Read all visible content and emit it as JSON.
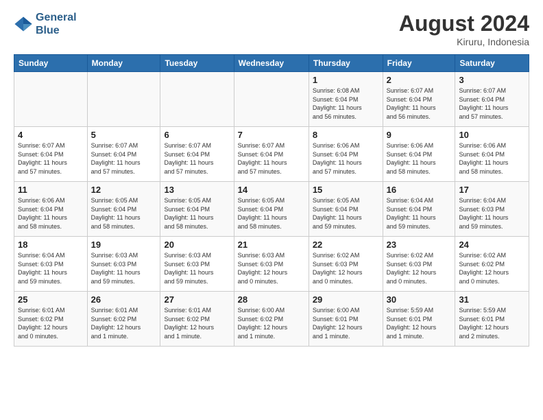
{
  "header": {
    "logo_line1": "General",
    "logo_line2": "Blue",
    "month_title": "August 2024",
    "subtitle": "Kiruru, Indonesia"
  },
  "weekdays": [
    "Sunday",
    "Monday",
    "Tuesday",
    "Wednesday",
    "Thursday",
    "Friday",
    "Saturday"
  ],
  "weeks": [
    [
      {
        "day": "",
        "info": ""
      },
      {
        "day": "",
        "info": ""
      },
      {
        "day": "",
        "info": ""
      },
      {
        "day": "",
        "info": ""
      },
      {
        "day": "1",
        "info": "Sunrise: 6:08 AM\nSunset: 6:04 PM\nDaylight: 11 hours\nand 56 minutes."
      },
      {
        "day": "2",
        "info": "Sunrise: 6:07 AM\nSunset: 6:04 PM\nDaylight: 11 hours\nand 56 minutes."
      },
      {
        "day": "3",
        "info": "Sunrise: 6:07 AM\nSunset: 6:04 PM\nDaylight: 11 hours\nand 57 minutes."
      }
    ],
    [
      {
        "day": "4",
        "info": "Sunrise: 6:07 AM\nSunset: 6:04 PM\nDaylight: 11 hours\nand 57 minutes."
      },
      {
        "day": "5",
        "info": "Sunrise: 6:07 AM\nSunset: 6:04 PM\nDaylight: 11 hours\nand 57 minutes."
      },
      {
        "day": "6",
        "info": "Sunrise: 6:07 AM\nSunset: 6:04 PM\nDaylight: 11 hours\nand 57 minutes."
      },
      {
        "day": "7",
        "info": "Sunrise: 6:07 AM\nSunset: 6:04 PM\nDaylight: 11 hours\nand 57 minutes."
      },
      {
        "day": "8",
        "info": "Sunrise: 6:06 AM\nSunset: 6:04 PM\nDaylight: 11 hours\nand 57 minutes."
      },
      {
        "day": "9",
        "info": "Sunrise: 6:06 AM\nSunset: 6:04 PM\nDaylight: 11 hours\nand 58 minutes."
      },
      {
        "day": "10",
        "info": "Sunrise: 6:06 AM\nSunset: 6:04 PM\nDaylight: 11 hours\nand 58 minutes."
      }
    ],
    [
      {
        "day": "11",
        "info": "Sunrise: 6:06 AM\nSunset: 6:04 PM\nDaylight: 11 hours\nand 58 minutes."
      },
      {
        "day": "12",
        "info": "Sunrise: 6:05 AM\nSunset: 6:04 PM\nDaylight: 11 hours\nand 58 minutes."
      },
      {
        "day": "13",
        "info": "Sunrise: 6:05 AM\nSunset: 6:04 PM\nDaylight: 11 hours\nand 58 minutes."
      },
      {
        "day": "14",
        "info": "Sunrise: 6:05 AM\nSunset: 6:04 PM\nDaylight: 11 hours\nand 58 minutes."
      },
      {
        "day": "15",
        "info": "Sunrise: 6:05 AM\nSunset: 6:04 PM\nDaylight: 11 hours\nand 59 minutes."
      },
      {
        "day": "16",
        "info": "Sunrise: 6:04 AM\nSunset: 6:04 PM\nDaylight: 11 hours\nand 59 minutes."
      },
      {
        "day": "17",
        "info": "Sunrise: 6:04 AM\nSunset: 6:03 PM\nDaylight: 11 hours\nand 59 minutes."
      }
    ],
    [
      {
        "day": "18",
        "info": "Sunrise: 6:04 AM\nSunset: 6:03 PM\nDaylight: 11 hours\nand 59 minutes."
      },
      {
        "day": "19",
        "info": "Sunrise: 6:03 AM\nSunset: 6:03 PM\nDaylight: 11 hours\nand 59 minutes."
      },
      {
        "day": "20",
        "info": "Sunrise: 6:03 AM\nSunset: 6:03 PM\nDaylight: 11 hours\nand 59 minutes."
      },
      {
        "day": "21",
        "info": "Sunrise: 6:03 AM\nSunset: 6:03 PM\nDaylight: 12 hours\nand 0 minutes."
      },
      {
        "day": "22",
        "info": "Sunrise: 6:02 AM\nSunset: 6:03 PM\nDaylight: 12 hours\nand 0 minutes."
      },
      {
        "day": "23",
        "info": "Sunrise: 6:02 AM\nSunset: 6:03 PM\nDaylight: 12 hours\nand 0 minutes."
      },
      {
        "day": "24",
        "info": "Sunrise: 6:02 AM\nSunset: 6:02 PM\nDaylight: 12 hours\nand 0 minutes."
      }
    ],
    [
      {
        "day": "25",
        "info": "Sunrise: 6:01 AM\nSunset: 6:02 PM\nDaylight: 12 hours\nand 0 minutes."
      },
      {
        "day": "26",
        "info": "Sunrise: 6:01 AM\nSunset: 6:02 PM\nDaylight: 12 hours\nand 1 minute."
      },
      {
        "day": "27",
        "info": "Sunrise: 6:01 AM\nSunset: 6:02 PM\nDaylight: 12 hours\nand 1 minute."
      },
      {
        "day": "28",
        "info": "Sunrise: 6:00 AM\nSunset: 6:02 PM\nDaylight: 12 hours\nand 1 minute."
      },
      {
        "day": "29",
        "info": "Sunrise: 6:00 AM\nSunset: 6:01 PM\nDaylight: 12 hours\nand 1 minute."
      },
      {
        "day": "30",
        "info": "Sunrise: 5:59 AM\nSunset: 6:01 PM\nDaylight: 12 hours\nand 1 minute."
      },
      {
        "day": "31",
        "info": "Sunrise: 5:59 AM\nSunset: 6:01 PM\nDaylight: 12 hours\nand 2 minutes."
      }
    ]
  ]
}
